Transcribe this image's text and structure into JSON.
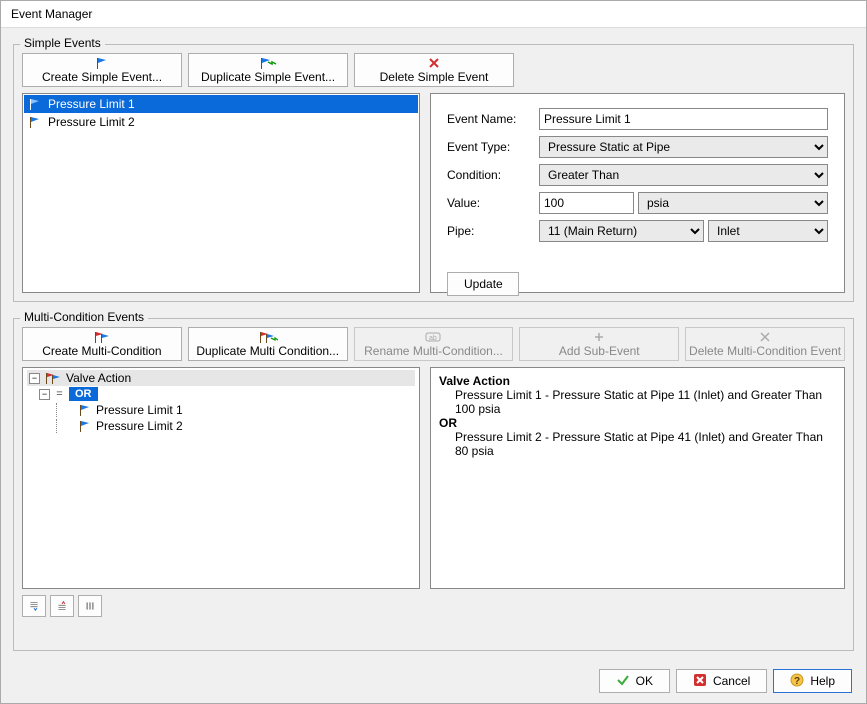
{
  "window": {
    "title": "Event Manager"
  },
  "simple_events": {
    "label": "Simple Events",
    "buttons": {
      "create": "Create Simple Event...",
      "duplicate": "Duplicate Simple Event...",
      "delete": "Delete Simple Event"
    },
    "items": [
      {
        "name": "Pressure Limit 1",
        "selected": true
      },
      {
        "name": "Pressure Limit 2",
        "selected": false
      }
    ],
    "form": {
      "labels": {
        "name": "Event Name:",
        "type": "Event Type:",
        "condition": "Condition:",
        "value": "Value:",
        "pipe": "Pipe:"
      },
      "name_value": "Pressure Limit 1",
      "type_value": "Pressure Static at Pipe",
      "condition_value": "Greater Than",
      "value_number": "100",
      "value_unit": "psia",
      "pipe_value": "11 (Main Return)",
      "pipe_end": "Inlet",
      "update": "Update"
    }
  },
  "multi_events": {
    "label": "Multi-Condition Events",
    "buttons": {
      "create": "Create Multi-Condition",
      "duplicate": "Duplicate Multi Condition...",
      "rename": "Rename Multi-Condition...",
      "addsub": "Add Sub-Event",
      "delete": "Delete Multi-Condition Event"
    },
    "tree": {
      "root": "Valve Action",
      "operator": "OR",
      "children": [
        "Pressure Limit 1",
        "Pressure Limit 2"
      ]
    },
    "preview": {
      "header": "Valve Action",
      "line1": "Pressure Limit 1 - Pressure Static at Pipe 11 (Inlet) and Greater Than 100 psia",
      "op": "OR",
      "line2": "Pressure Limit 2 - Pressure Static at Pipe 41 (Inlet) and Greater Than 80 psia"
    }
  },
  "footer": {
    "ok": "OK",
    "cancel": "Cancel",
    "help": "Help"
  }
}
